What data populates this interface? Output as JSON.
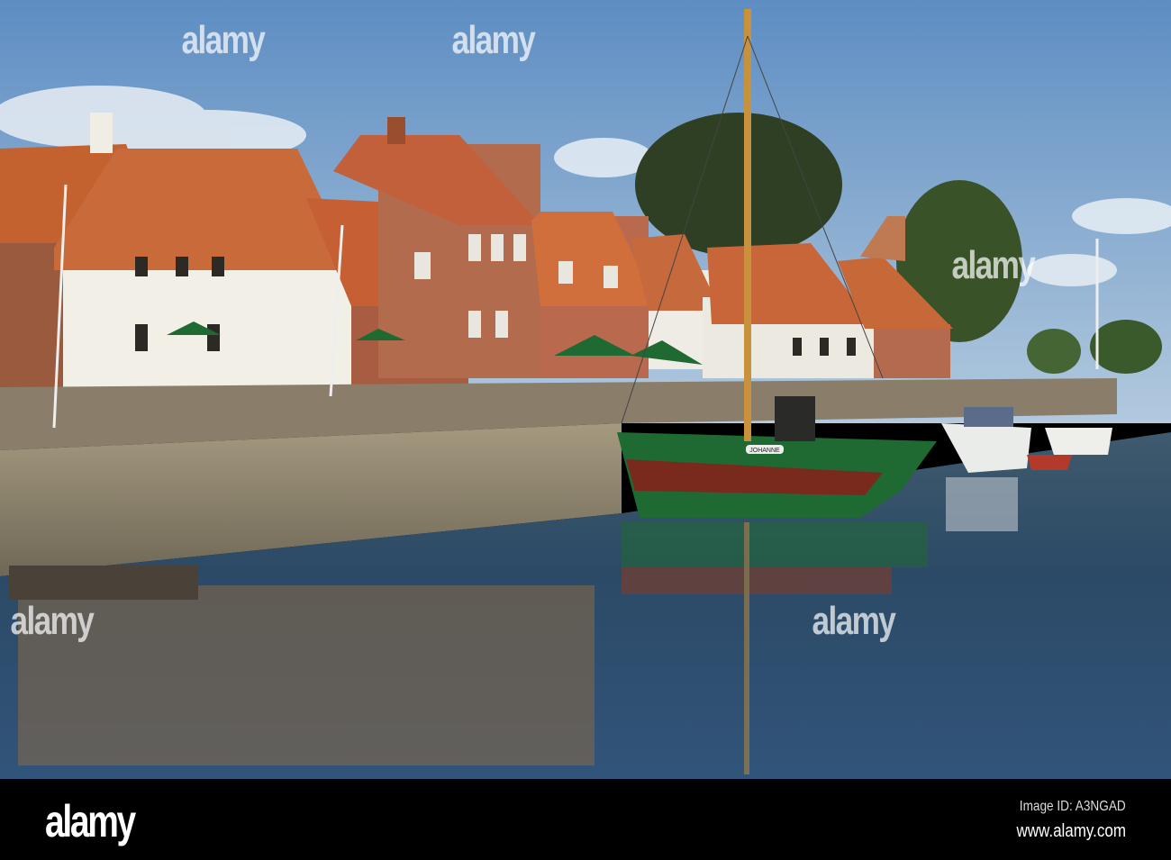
{
  "photo": {
    "subject": "harbour",
    "boat_name": "JOHANNE",
    "colors": {
      "sky": "#6f9ccc",
      "water": "#2c4a66",
      "roof": "#c8643a",
      "hull_green": "#1f6a32",
      "hull_red": "#7a2a1c"
    }
  },
  "watermark": "alamy",
  "footer": {
    "logo": "alamy",
    "image_id": "Image ID: A3NGAD",
    "website": "www.alamy.com"
  }
}
